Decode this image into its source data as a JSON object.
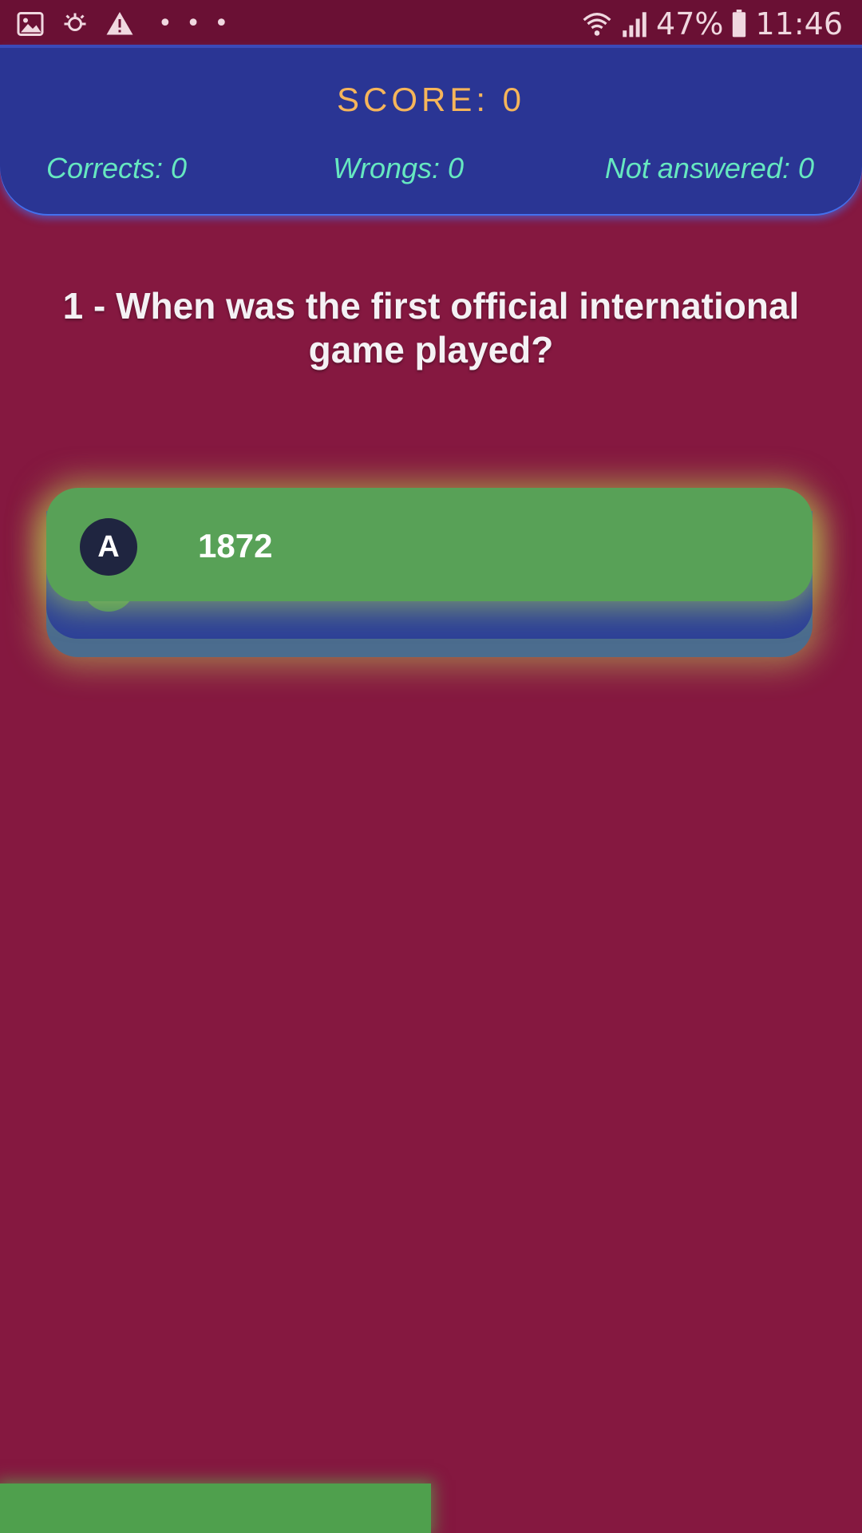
{
  "status_bar": {
    "left_icons": [
      "gallery-icon",
      "sync-icon",
      "warning-icon"
    ],
    "more": "• • •",
    "battery_percent": "47%",
    "time": "11:46"
  },
  "score_panel": {
    "score_text": "SCORE: 0",
    "corrects": "Corrects: 0",
    "wrongs": "Wrongs: 0",
    "not_answered": "Not answered: 0"
  },
  "question": {
    "text": "1 - When was the first official international game played?"
  },
  "answer": {
    "letter": "A",
    "text": "1872"
  },
  "colors": {
    "background": "#851840",
    "panel": "#2a3594",
    "score": "#f6b55a",
    "stats": "#66e8c0",
    "answer": "#58a157",
    "progress": "#4fa04d"
  },
  "progress": {
    "fraction": 0.5
  }
}
